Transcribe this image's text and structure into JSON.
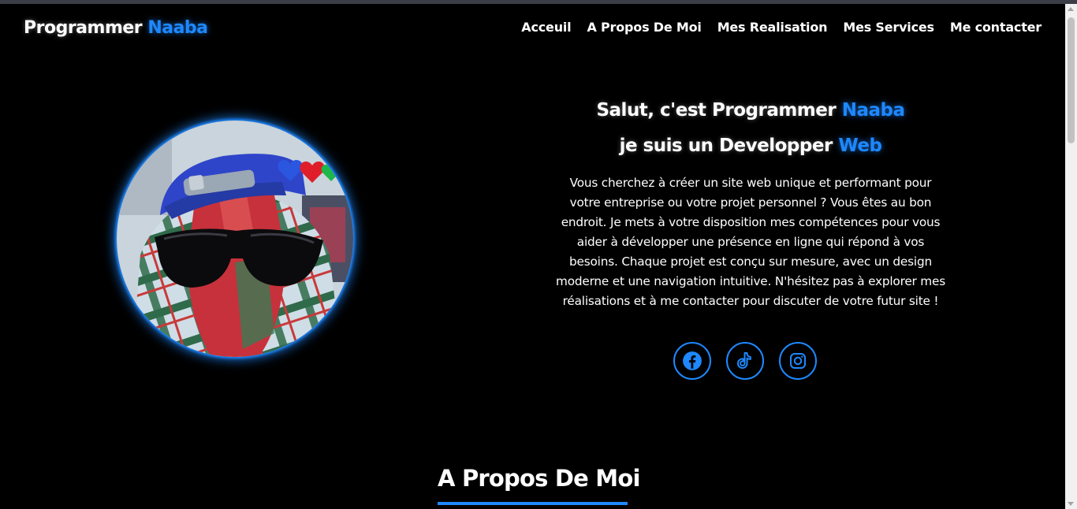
{
  "header": {
    "logo_part1": "Programmer",
    "logo_part2": "Naaba",
    "nav": [
      {
        "label": "Acceuil"
      },
      {
        "label": "A Propos De Moi"
      },
      {
        "label": "Mes Realisation"
      },
      {
        "label": "Mes Services"
      },
      {
        "label": "Me contacter"
      }
    ]
  },
  "hero": {
    "line1_prefix": "Salut, c'est Programmer",
    "line1_accent": "Naaba",
    "line2_prefix": "je suis un Developper",
    "line2_accent": "Web",
    "description": "Vous cherchez à créer un site web unique et performant pour votre entreprise ou votre projet personnel ? Vous êtes au bon endroit. Je mets à votre disposition mes compétences pour vous aider à développer une présence en ligne qui répond à vos besoins. Chaque projet est conçu sur mesure, avec un design moderne et une navigation intuitive. N'hésitez pas à explorer mes réalisations et à me contacter pour discuter de votre futur site !",
    "socials": [
      {
        "icon": "facebook-icon"
      },
      {
        "icon": "tiktok-icon"
      },
      {
        "icon": "instagram-icon"
      }
    ]
  },
  "about": {
    "title": "A Propos De Moi"
  },
  "colors": {
    "accent": "#1e88ff",
    "background": "#000000",
    "text": "#ffffff"
  }
}
